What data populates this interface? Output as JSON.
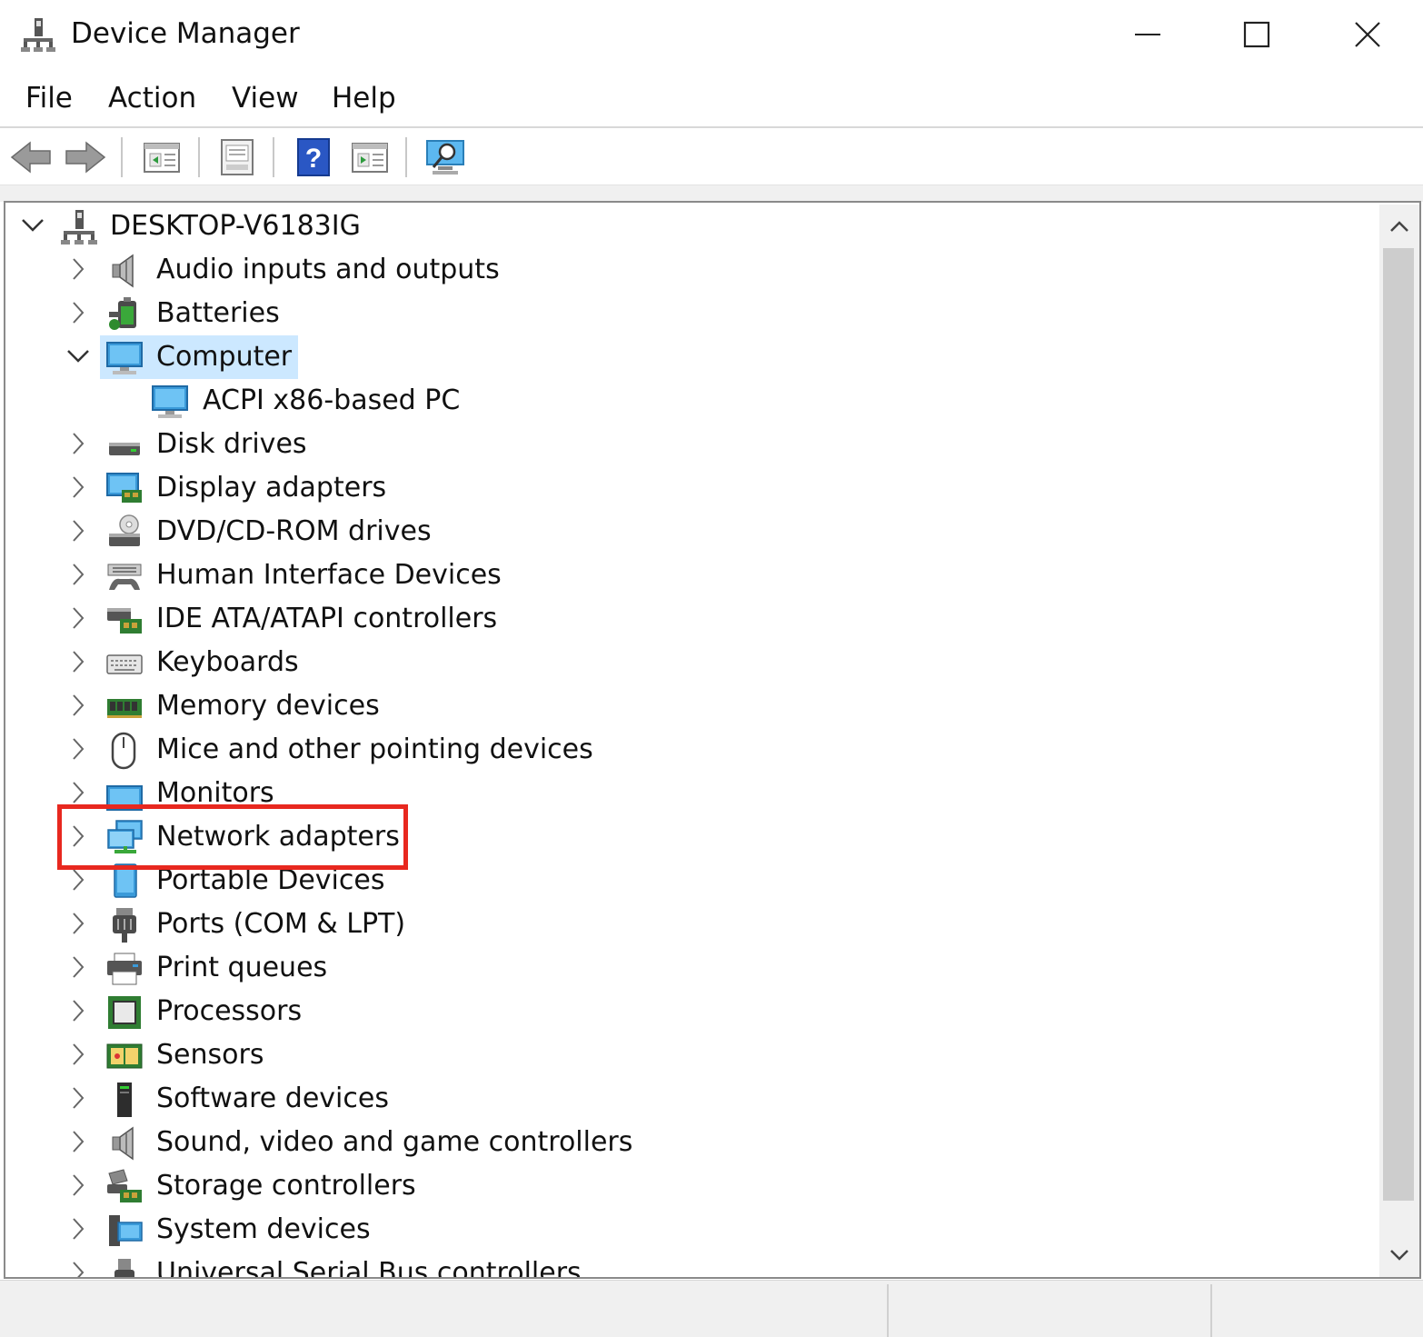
{
  "window": {
    "title": "Device Manager",
    "controls": {
      "minimize": "minimize-icon",
      "maximize": "maximize-icon",
      "close": "close-icon"
    }
  },
  "menu": [
    "File",
    "Action",
    "View",
    "Help"
  ],
  "toolbar": {
    "buttons": [
      "back-arrow-icon",
      "forward-arrow-icon",
      "properties-icon",
      "update-driver-icon",
      "help-icon",
      "show-hidden-icon",
      "scan-hardware-icon"
    ]
  },
  "tree": {
    "root": "DESKTOP-V6183IG",
    "nodes": [
      {
        "label": "Audio inputs and outputs",
        "icon": "speaker-icon",
        "expanded": false
      },
      {
        "label": "Batteries",
        "icon": "battery-icon",
        "expanded": false
      },
      {
        "label": "Computer",
        "icon": "computer-icon",
        "expanded": true,
        "selected": true
      },
      {
        "label": "ACPI x86-based PC",
        "icon": "computer-icon",
        "child": true
      },
      {
        "label": "Disk drives",
        "icon": "disk-drive-icon",
        "expanded": false
      },
      {
        "label": "Display adapters",
        "icon": "display-adapter-icon",
        "expanded": false
      },
      {
        "label": "DVD/CD-ROM drives",
        "icon": "dvd-drive-icon",
        "expanded": false
      },
      {
        "label": "Human Interface Devices",
        "icon": "hid-icon",
        "expanded": false
      },
      {
        "label": "IDE ATA/ATAPI controllers",
        "icon": "ide-controller-icon",
        "expanded": false
      },
      {
        "label": "Keyboards",
        "icon": "keyboard-icon",
        "expanded": false
      },
      {
        "label": "Memory devices",
        "icon": "memory-icon",
        "expanded": false
      },
      {
        "label": "Mice and other pointing devices",
        "icon": "mouse-icon",
        "expanded": false
      },
      {
        "label": "Monitors",
        "icon": "monitor-icon",
        "expanded": false
      },
      {
        "label": "Network adapters",
        "icon": "network-adapter-icon",
        "expanded": false,
        "highlighted": true
      },
      {
        "label": "Portable Devices",
        "icon": "portable-device-icon",
        "expanded": false
      },
      {
        "label": "Ports (COM & LPT)",
        "icon": "port-icon",
        "expanded": false
      },
      {
        "label": "Print queues",
        "icon": "printer-icon",
        "expanded": false
      },
      {
        "label": "Processors",
        "icon": "processor-icon",
        "expanded": false
      },
      {
        "label": "Sensors",
        "icon": "sensor-icon",
        "expanded": false
      },
      {
        "label": "Software devices",
        "icon": "software-device-icon",
        "expanded": false
      },
      {
        "label": "Sound, video and game controllers",
        "icon": "speaker-icon",
        "expanded": false
      },
      {
        "label": "Storage controllers",
        "icon": "storage-controller-icon",
        "expanded": false
      },
      {
        "label": "System devices",
        "icon": "system-device-icon",
        "expanded": false
      },
      {
        "label": "Universal Serial Bus controllers",
        "icon": "usb-icon",
        "expanded": false
      }
    ]
  },
  "colors": {
    "selection": "#cce8ff",
    "highlight_border": "#e8281f",
    "monitor_blue": "#3a9ad9"
  }
}
